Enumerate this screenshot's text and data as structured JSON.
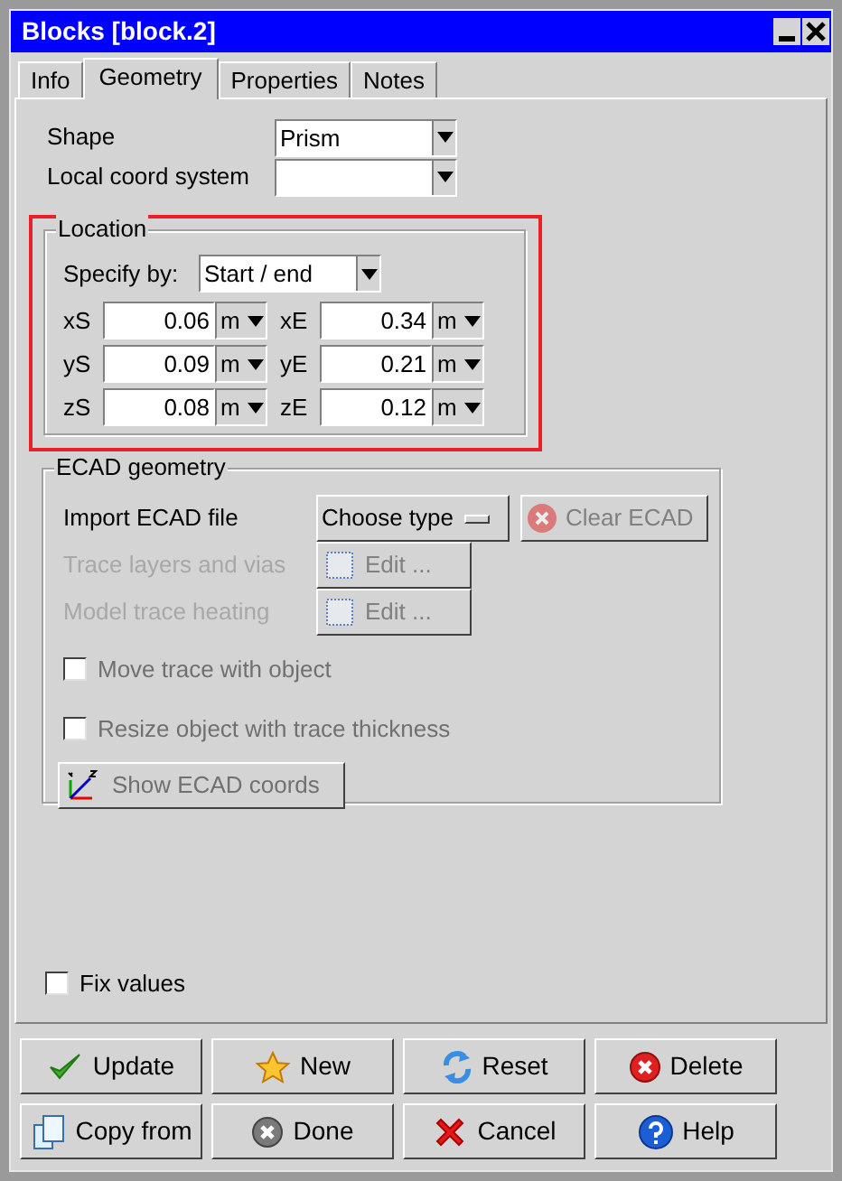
{
  "window": {
    "title": "Blocks [block.2]"
  },
  "tabs": [
    {
      "label": "Info",
      "selected": false
    },
    {
      "label": "Geometry",
      "selected": true
    },
    {
      "label": "Properties",
      "selected": false
    },
    {
      "label": "Notes",
      "selected": false
    }
  ],
  "shape": {
    "label": "Shape",
    "value": "Prism"
  },
  "local_coord_system": {
    "label": "Local coord system"
  },
  "location": {
    "title": "Location",
    "specify_by": {
      "label": "Specify by:",
      "value": "Start / end"
    },
    "rows": [
      {
        "start_label": "xS",
        "start": "0.06",
        "start_unit": "m",
        "end_label": "xE",
        "end": "0.34",
        "end_unit": "m"
      },
      {
        "start_label": "yS",
        "start": "0.09",
        "start_unit": "m",
        "end_label": "yE",
        "end": "0.21",
        "end_unit": "m"
      },
      {
        "start_label": "zS",
        "start": "0.08",
        "start_unit": "m",
        "end_label": "zE",
        "end": "0.12",
        "end_unit": "m"
      }
    ]
  },
  "ecad": {
    "title": "ECAD geometry",
    "import": {
      "label": "Import ECAD file",
      "choose": "Choose type",
      "clear": "Clear ECAD",
      "clear_disabled": true
    },
    "edits": [
      {
        "label": "Trace layers and vias",
        "button": "Edit ...",
        "disabled": true
      },
      {
        "label": "Model trace heating",
        "button": "Edit ...",
        "disabled": true
      }
    ],
    "checkboxes": [
      {
        "label": "Move trace with object",
        "checked": false,
        "disabled": true
      },
      {
        "label": "Resize object with trace thickness",
        "checked": false,
        "disabled": true
      }
    ],
    "coords_button": {
      "label": "Show ECAD coords",
      "disabled": true
    }
  },
  "fix_values": {
    "label": "Fix values",
    "checked": false
  },
  "buttons": [
    {
      "label": "Update",
      "kind": "check"
    },
    {
      "label": "New",
      "kind": "star"
    },
    {
      "label": "Reset",
      "kind": "reset"
    },
    {
      "label": "Delete",
      "kind": "delete"
    },
    {
      "label": "Copy from",
      "kind": "copy"
    },
    {
      "label": "Done",
      "kind": "done"
    },
    {
      "label": "Cancel",
      "kind": "cancel"
    },
    {
      "label": "Help",
      "kind": "help"
    }
  ]
}
